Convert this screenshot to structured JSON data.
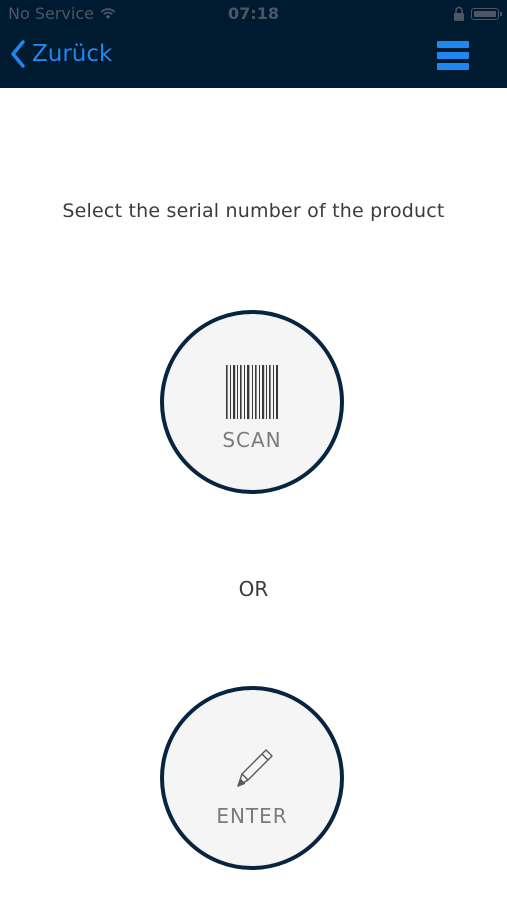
{
  "status_bar": {
    "carrier": "No Service",
    "time": "07:18",
    "icons": [
      "wifi-icon",
      "lock-icon",
      "battery-icon"
    ]
  },
  "nav": {
    "back_label": "Zurück",
    "menu_icon": "hamburger-menu-icon"
  },
  "main": {
    "instruction": "Select the serial number of the product",
    "scan_label": "SCAN",
    "scan_icon": "barcode-icon",
    "or_label": "OR",
    "enter_label": "ENTER",
    "enter_icon": "pencil-icon"
  },
  "colors": {
    "header_bg": "#001a30",
    "accent": "#1f87ef",
    "circle_border": "#072540",
    "circle_fill": "#f5f5f5"
  }
}
